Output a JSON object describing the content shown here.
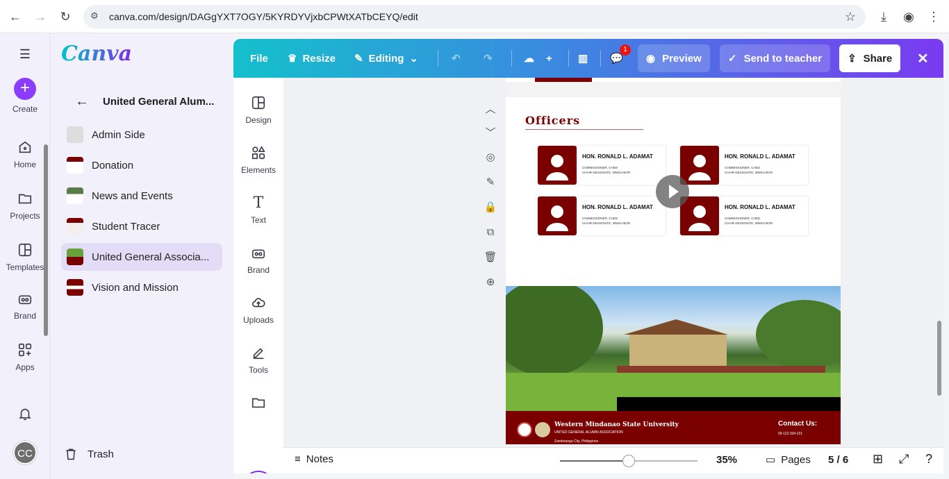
{
  "browser": {
    "url": "canva.com/design/DAGgYXT7OGY/5KYRDYVjxbCPWtXATbCEYQ/edit"
  },
  "rail": {
    "create": "Create",
    "home": "Home",
    "projects": "Projects",
    "templates": "Templates",
    "brand": "Brand",
    "apps": "Apps",
    "avatar": "CC"
  },
  "panel": {
    "logo": "Canva",
    "title": "United General Alum...",
    "folders": [
      {
        "label": "Admin Side"
      },
      {
        "label": "Donation"
      },
      {
        "label": "News and Events"
      },
      {
        "label": "Student Tracer"
      },
      {
        "label": "United General Associa..."
      },
      {
        "label": "Vision and Mission"
      }
    ],
    "trash": "Trash"
  },
  "toolbar": {
    "file": "File",
    "resize": "Resize",
    "editing": "Editing",
    "comments_badge": "1",
    "preview": "Preview",
    "send": "Send to teacher",
    "share": "Share"
  },
  "tools": {
    "design": "Design",
    "elements": "Elements",
    "text": "Text",
    "brand": "Brand",
    "uploads": "Uploads",
    "tools": "Tools"
  },
  "canvas": {
    "section_title": "Officers",
    "officers": [
      {
        "name": "HON. RONALD L. ADAMAT",
        "line1": "COMMISSIONER, CHED",
        "line2": "CHAIR-DESIGNATE, WMSU-BOR"
      },
      {
        "name": "HON. RONALD L. ADAMAT",
        "line1": "COMMISSIONER, CHED",
        "line2": "CHAIR-DESIGNATE, WMSU-BOR"
      },
      {
        "name": "HON. RONALD L. ADAMAT",
        "line1": "COMMISSIONER, CHED",
        "line2": "CHAIR-DESIGNATE, WMSU-BOR"
      },
      {
        "name": "HON. RONALD L. ADAMAT",
        "line1": "COMMISSIONER, CHED",
        "line2": "CHAIR-DESIGNATE, WMSU-BOR"
      }
    ],
    "footer": {
      "university": "Western Mindanao State University",
      "association": "UNITED GENERAL ALUMNI ASSOCIATION",
      "city": "Zamboanga City, Philippines",
      "contact_title": "Contact Us:",
      "phone": "09-112-334-221"
    }
  },
  "bottom": {
    "notes": "Notes",
    "zoom": "35%",
    "zoom_fraction": 0.5,
    "pages": "Pages",
    "page_count": "5 / 6"
  },
  "colors": {
    "accent": "#8b3dff",
    "maroon": "#7a0000"
  }
}
